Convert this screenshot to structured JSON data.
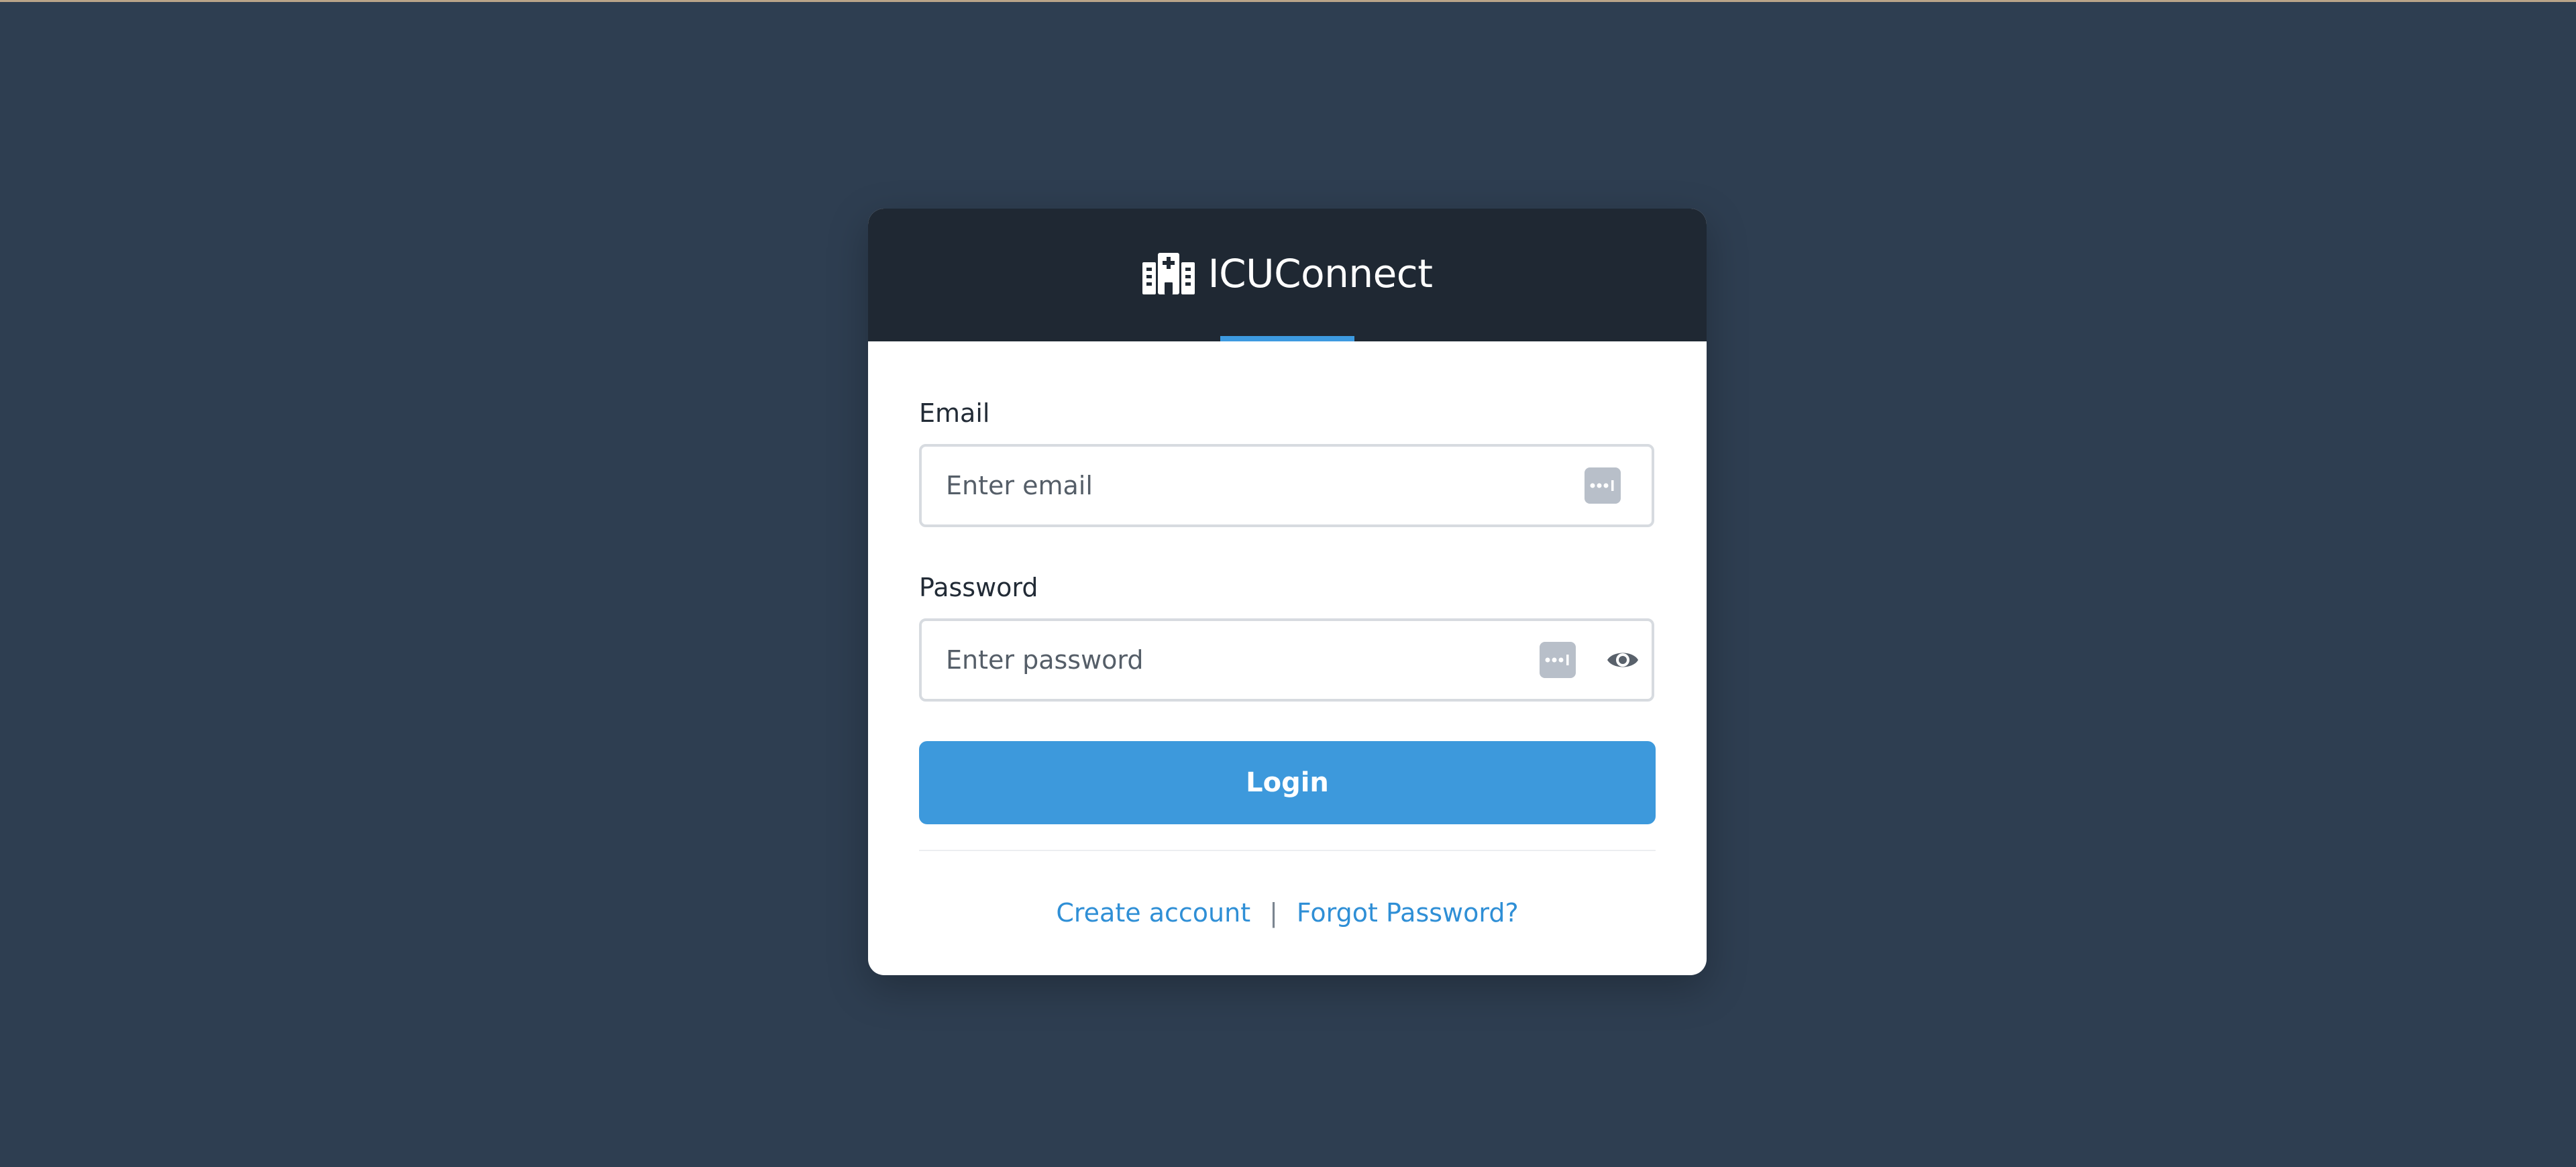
{
  "app": {
    "name": "ICUConnect",
    "icon": "hospital-icon"
  },
  "form": {
    "email": {
      "label": "Email",
      "placeholder": "Enter email",
      "value": ""
    },
    "password": {
      "label": "Password",
      "placeholder": "Enter password",
      "value": ""
    },
    "login_label": "Login"
  },
  "links": {
    "create_account": "Create account",
    "separator": "|",
    "forgot_password": "Forgot Password?"
  },
  "colors": {
    "background": "#2e3e51",
    "header": "#1f2833",
    "accent": "#3d99dc",
    "link": "#2f8fd6"
  }
}
